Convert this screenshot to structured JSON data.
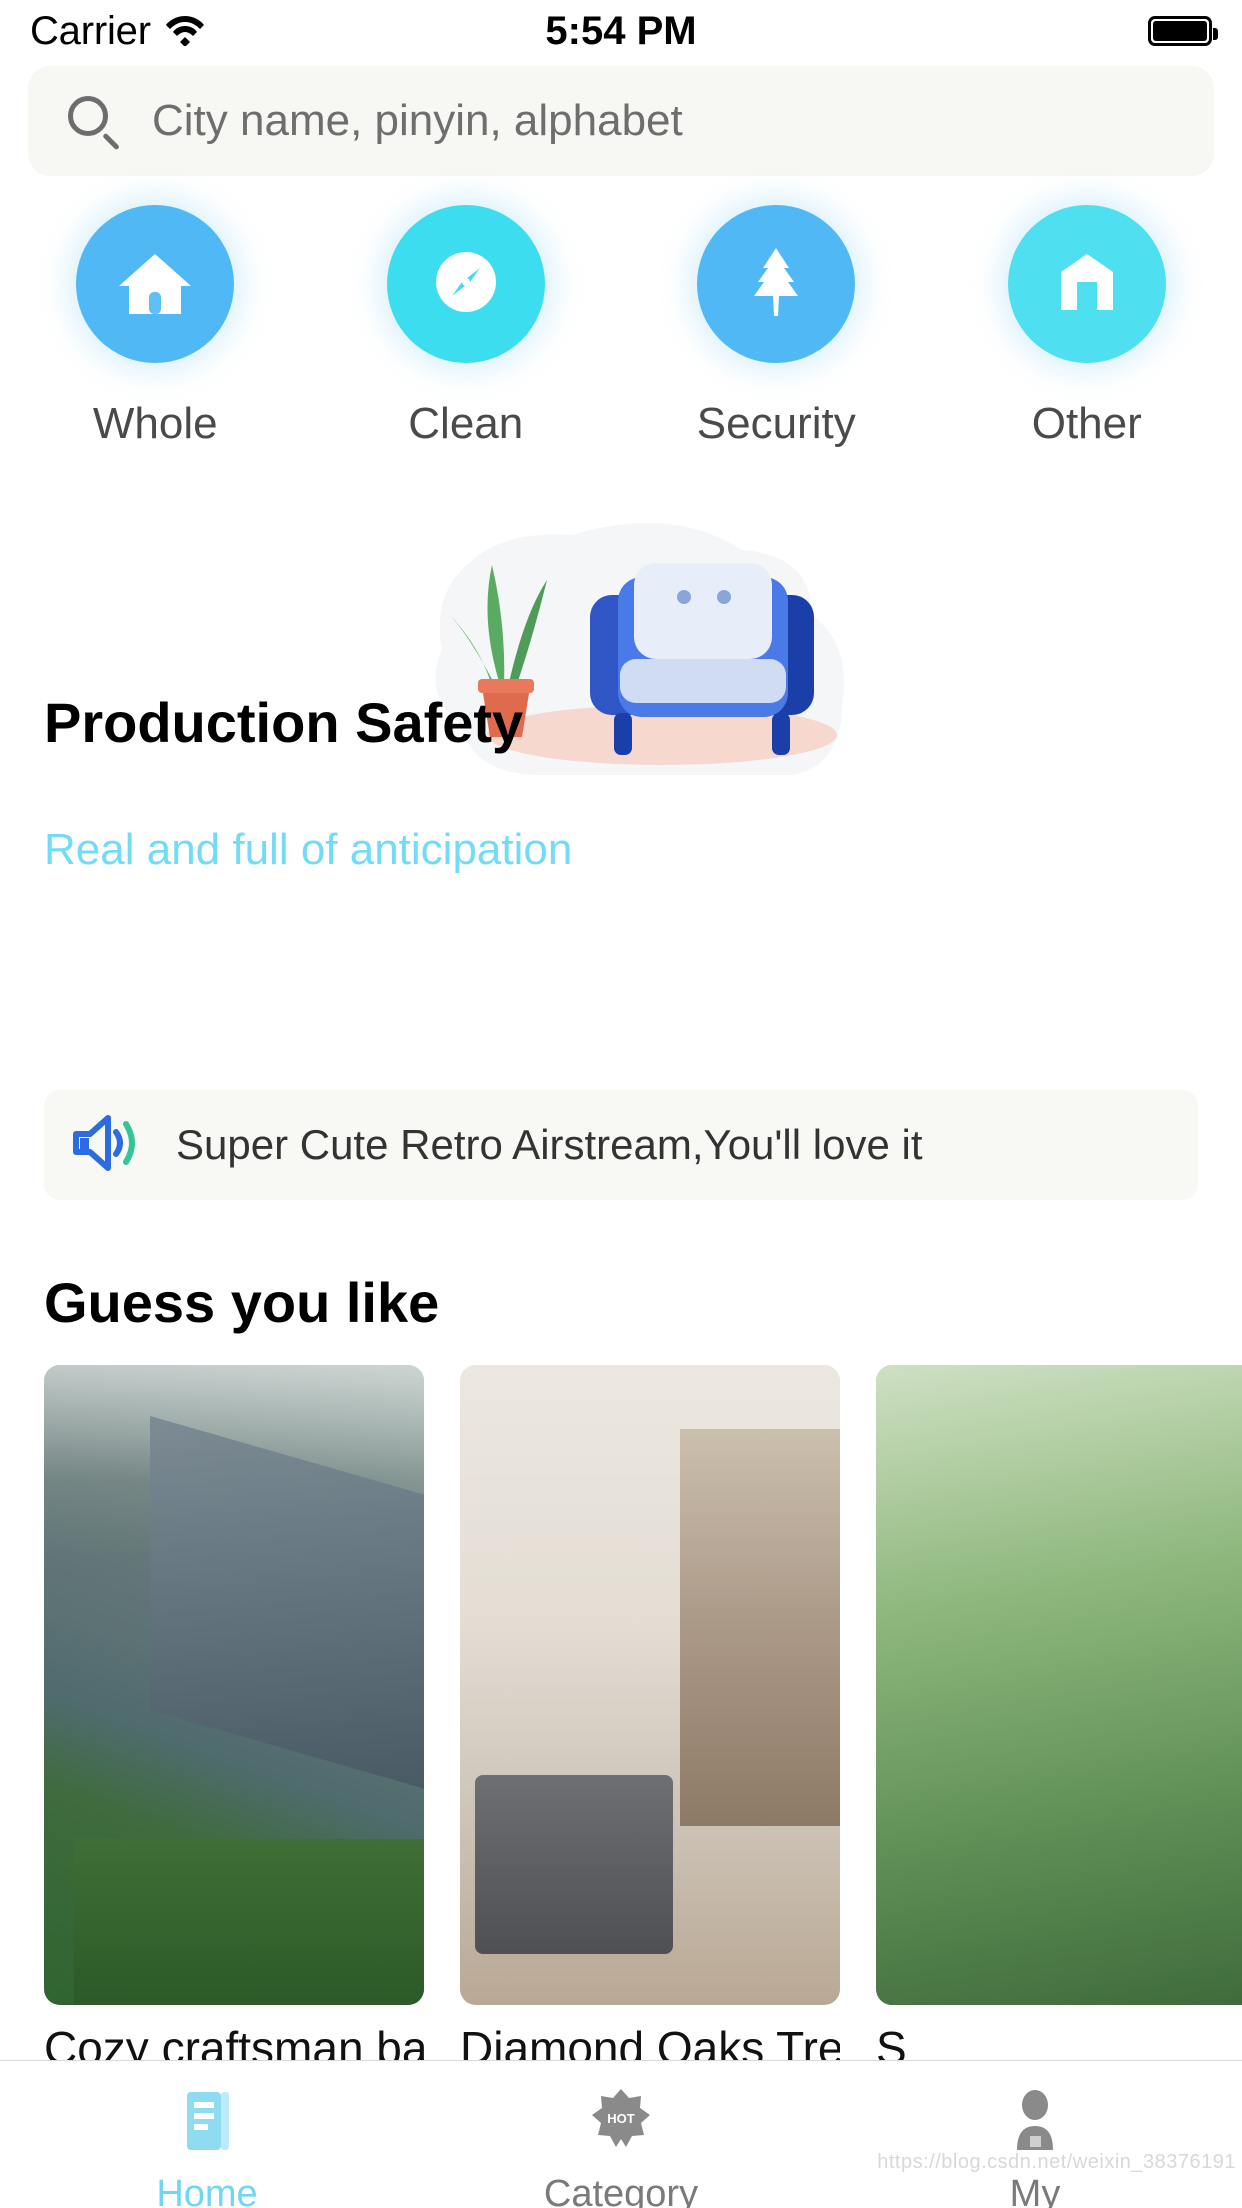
{
  "status_bar": {
    "carrier": "Carrier",
    "time": "5:54 PM",
    "wifi_icon": "wifi-icon",
    "battery_icon": "battery-icon"
  },
  "search": {
    "placeholder": "City name, pinyin, alphabet",
    "value": "",
    "icon": "search-icon"
  },
  "categories": [
    {
      "label": "Whole",
      "icon": "house-icon",
      "color": "#4FB8F5"
    },
    {
      "label": "Clean",
      "icon": "compass-icon",
      "color": "#3DDDF0"
    },
    {
      "label": "Security",
      "icon": "leaf-icon",
      "color": "#4FB8F5"
    },
    {
      "label": "Other",
      "icon": "store-icon",
      "color": "#4EE0F0"
    }
  ],
  "banner": {
    "title": "Production Safety",
    "subtitle": "Real and full of anticipation",
    "subtitle_color": "#72dcf7",
    "art_icon": "armchair-plant-illustration"
  },
  "notice": {
    "icon": "speaker-icon",
    "text": "Super Cute Retro Airstream,You'll love it",
    "icon_color": "#2D6BE0",
    "wave_color": "#35C39A"
  },
  "recommendations": {
    "title": "Guess you like",
    "cards": [
      {
        "title": "Cozy craftsman barn",
        "image": "barn-exterior-photo"
      },
      {
        "title": "Diamond Oaks Treeh",
        "image": "living-room-kitchen-photo"
      },
      {
        "title": "S",
        "image": "treehouse-garden-photo"
      }
    ]
  },
  "tab_bar": {
    "items": [
      {
        "label": "Home",
        "icon": "book-icon",
        "active": true
      },
      {
        "label": "Category",
        "icon": "hot-badge-icon",
        "active": false
      },
      {
        "label": "My",
        "icon": "person-icon",
        "active": false
      }
    ],
    "active_color": "#6fd7f2",
    "inactive_color": "#7a7a7a"
  },
  "watermark": "https://blog.csdn.net/weixin_38376191"
}
